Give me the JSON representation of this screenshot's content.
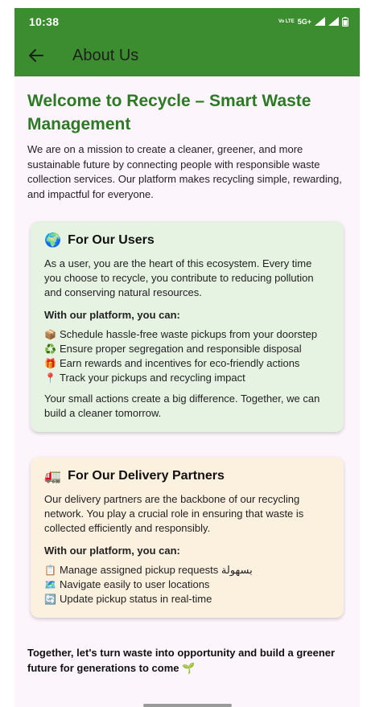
{
  "status_bar": {
    "time": "10:38",
    "network": "Vo LTE",
    "signal_label": "5G+"
  },
  "app_bar": {
    "title": "About Us",
    "back_icon": "arrow-left-icon"
  },
  "welcome": {
    "title": "Welcome to Recycle – Smart Waste Management",
    "intro": "We are on a mission to create a cleaner, greener, and more sustainable future by connecting people with responsible waste collection services. Our platform makes recycling simple, rewarding, and impactful for everyone."
  },
  "users_card": {
    "icon": "🌍",
    "title": "For Our Users",
    "description": "As a user, you are the heart of this ecosystem. Every time you choose to recycle, you contribute to reducing pollution and conserving natural resources.",
    "can_label": "With our platform, you can:",
    "features": [
      {
        "icon": "📦",
        "text": "Schedule hassle-free waste pickups from your doorstep"
      },
      {
        "icon": "♻️",
        "text": "Ensure proper segregation and responsible disposal"
      },
      {
        "icon": "🎁",
        "text": "Earn rewards and incentives for eco-friendly actions"
      },
      {
        "icon": "📍",
        "text": "Track your pickups and recycling impact"
      }
    ],
    "closing": "Your small actions create a big difference. Together, we can build a cleaner tomorrow."
  },
  "partners_card": {
    "icon": "🚛",
    "title": "For Our Delivery Partners",
    "description": "Our delivery partners are the backbone of our recycling network. You play a crucial role in ensuring that waste is collected efficiently and responsibly.",
    "can_label": "With our platform, you can:",
    "features": [
      {
        "icon": "📋",
        "text": "Manage assigned pickup requests بسهولة"
      },
      {
        "icon": "🗺️",
        "text": "Navigate easily to user locations"
      },
      {
        "icon": "🔄",
        "text": "Update pickup status in real-time"
      }
    ]
  },
  "outro": "Together, let's turn waste into opportunity and build a greener future for generations to come 🌱",
  "colors": {
    "primary": "#3c8d2f",
    "title_green": "#2d7a24",
    "background": "#fdf5fc",
    "users_card_bg": "#e6f3e3",
    "partners_card_bg": "#fcf0df"
  }
}
